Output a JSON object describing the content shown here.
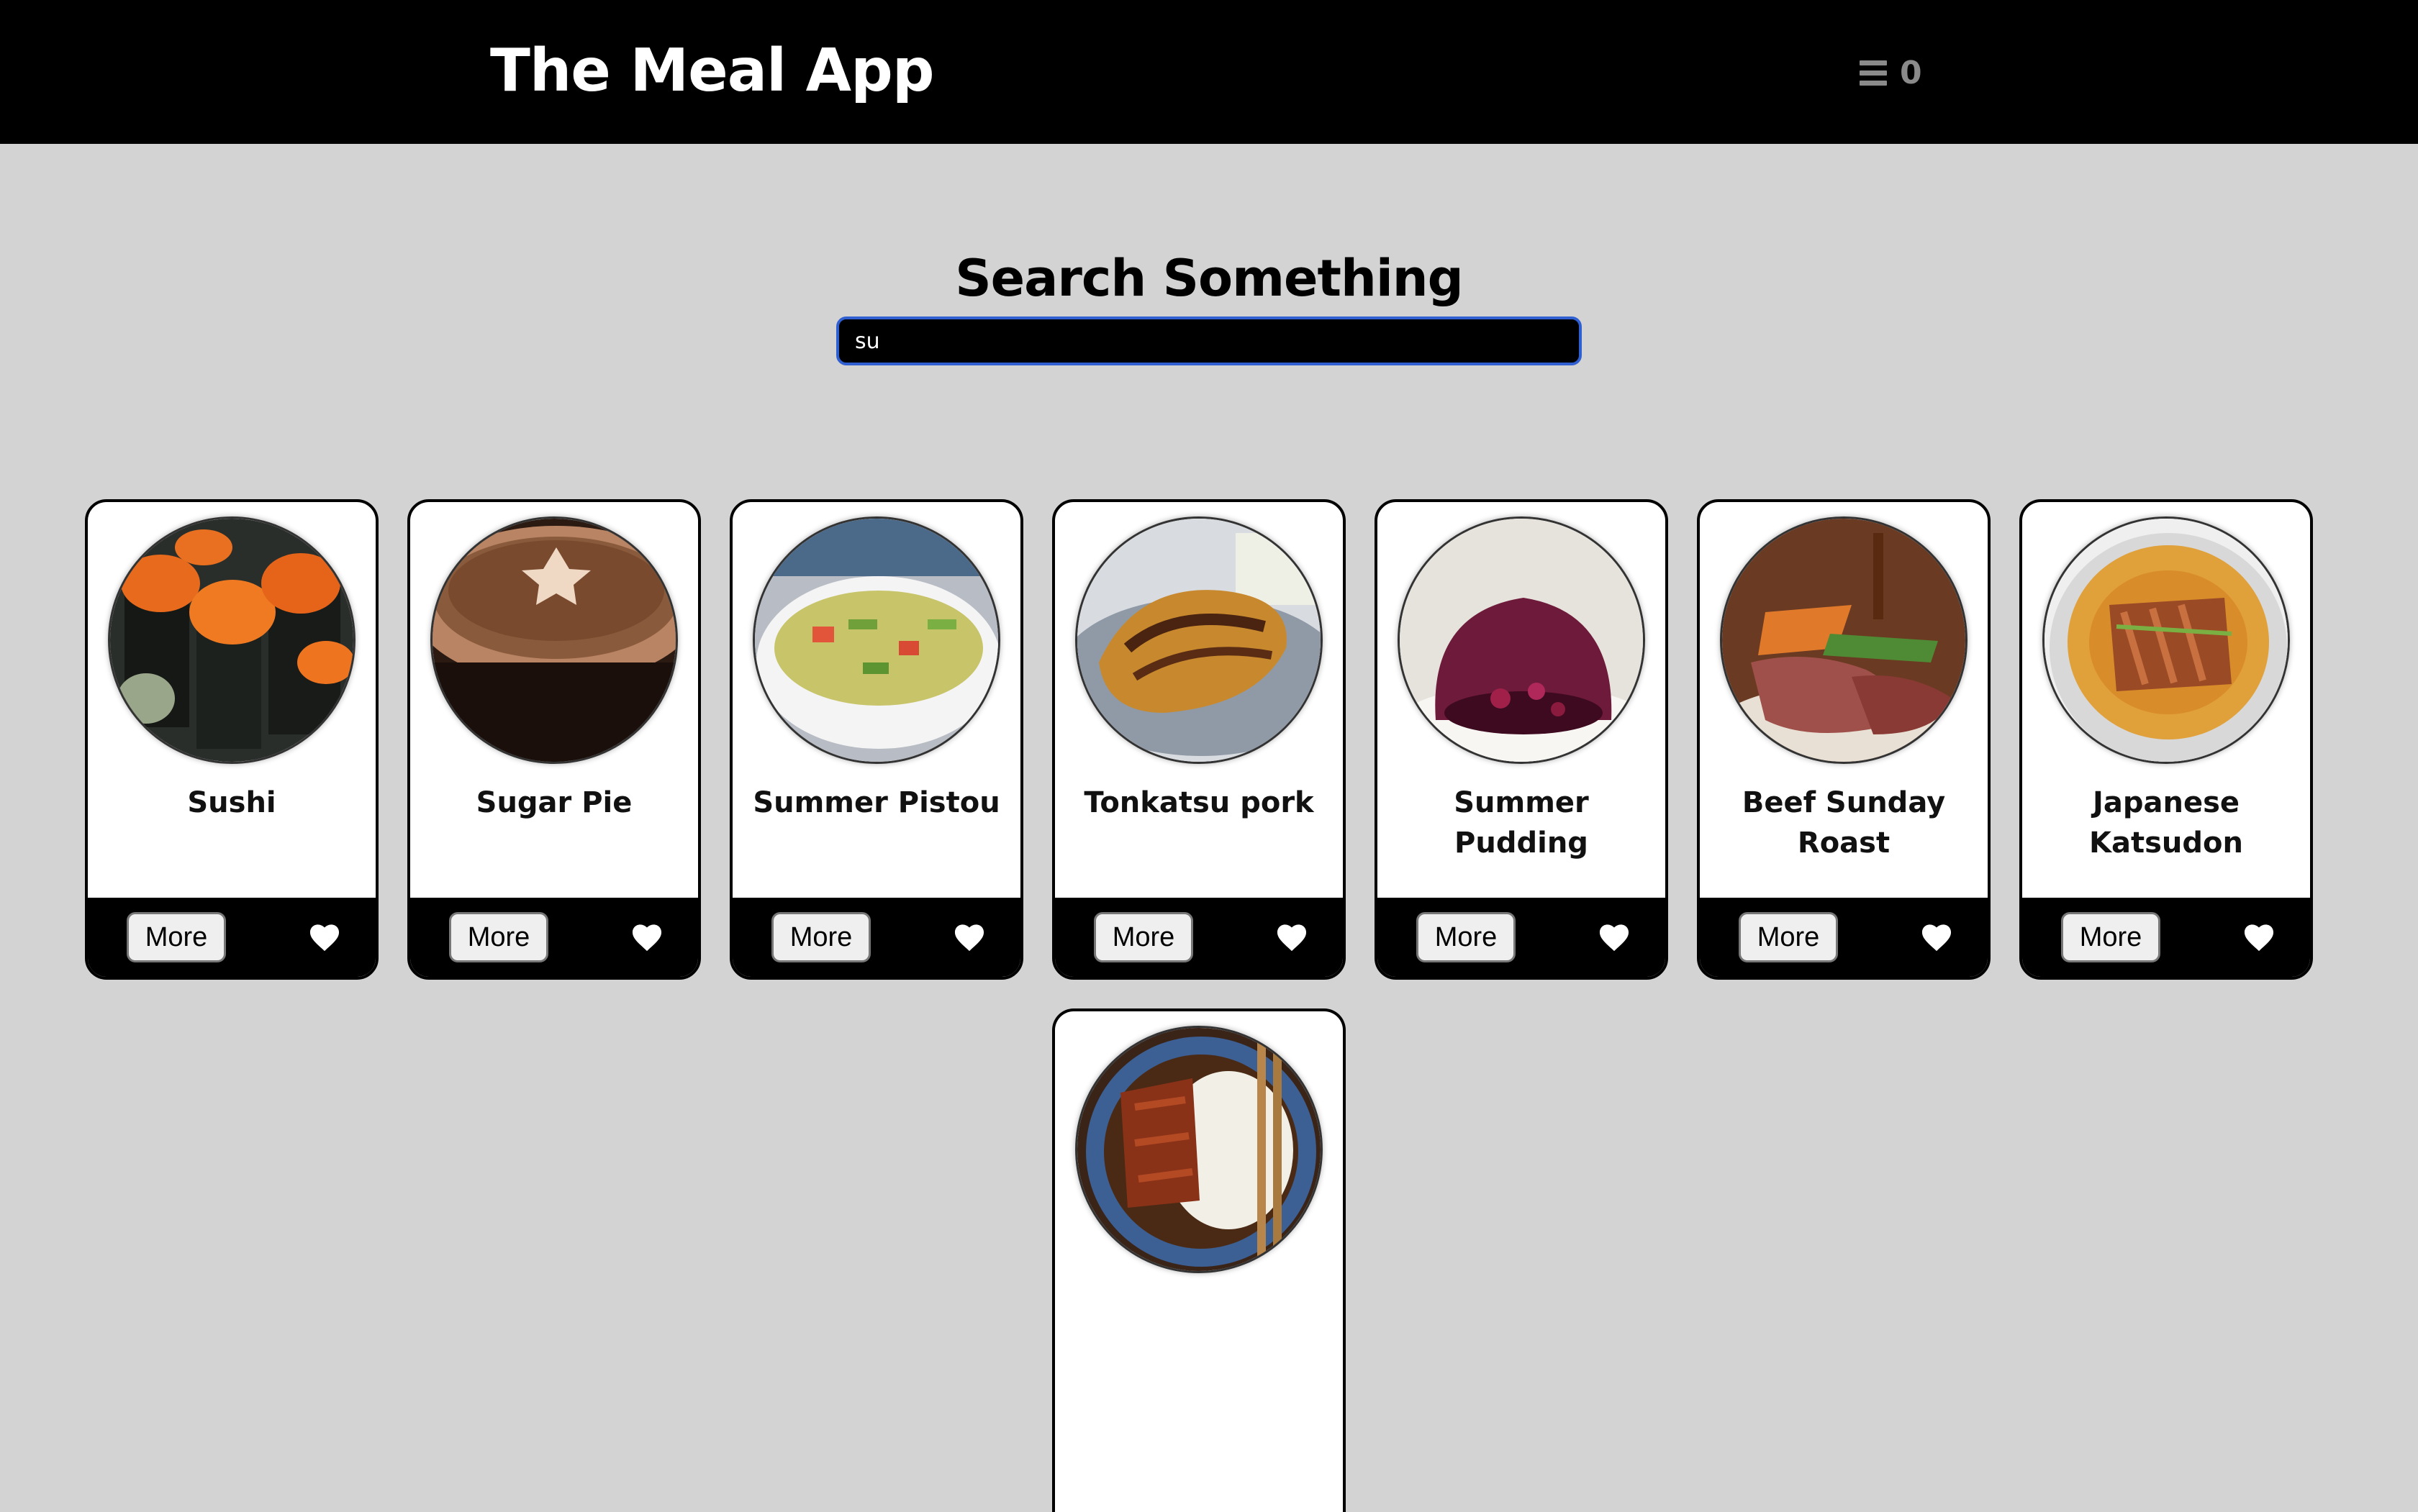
{
  "header": {
    "app_title": "The Meal App",
    "favorites_count": "0",
    "menu_icon": "hamburger-menu-icon"
  },
  "search": {
    "title": "Search Something",
    "value": "su",
    "placeholder": ""
  },
  "meals": [
    {
      "name": "Sushi",
      "more_label": "More",
      "icon": "heart-icon"
    },
    {
      "name": "Sugar Pie",
      "more_label": "More",
      "icon": "heart-icon"
    },
    {
      "name": "Summer Pistou",
      "more_label": "More",
      "icon": "heart-icon"
    },
    {
      "name": "Tonkatsu pork",
      "more_label": "More",
      "icon": "heart-icon"
    },
    {
      "name": "Summer Pudding",
      "more_label": "More",
      "icon": "heart-icon"
    },
    {
      "name": "Beef Sunday Roast",
      "more_label": "More",
      "icon": "heart-icon"
    },
    {
      "name": "Japanese Katsudon",
      "more_label": "More",
      "icon": "heart-icon"
    }
  ],
  "colors": {
    "navbar": "#000000",
    "background": "#d3d3d3",
    "input_border": "#2f5fd1"
  }
}
